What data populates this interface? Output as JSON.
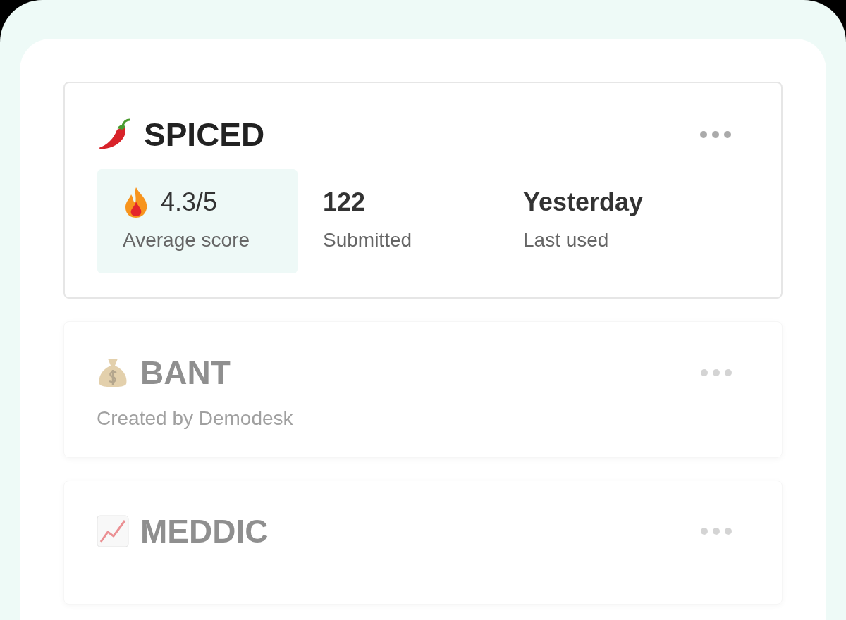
{
  "templates": [
    {
      "kind": "stats",
      "name": "SPICED",
      "faded": false,
      "stats": [
        {
          "value": "4.3/5",
          "label": "Average score",
          "highlighted": true
        },
        {
          "value": "122",
          "label": "Submitted",
          "highlighted": false
        },
        {
          "value": "Yesterday",
          "label": "Last used",
          "highlighted": false
        }
      ]
    },
    {
      "kind": "subtitle",
      "name": "BANT",
      "faded": true,
      "subtitle": "Created by Demodesk"
    },
    {
      "kind": "plain",
      "name": "MEDDIC",
      "faded": true
    }
  ]
}
